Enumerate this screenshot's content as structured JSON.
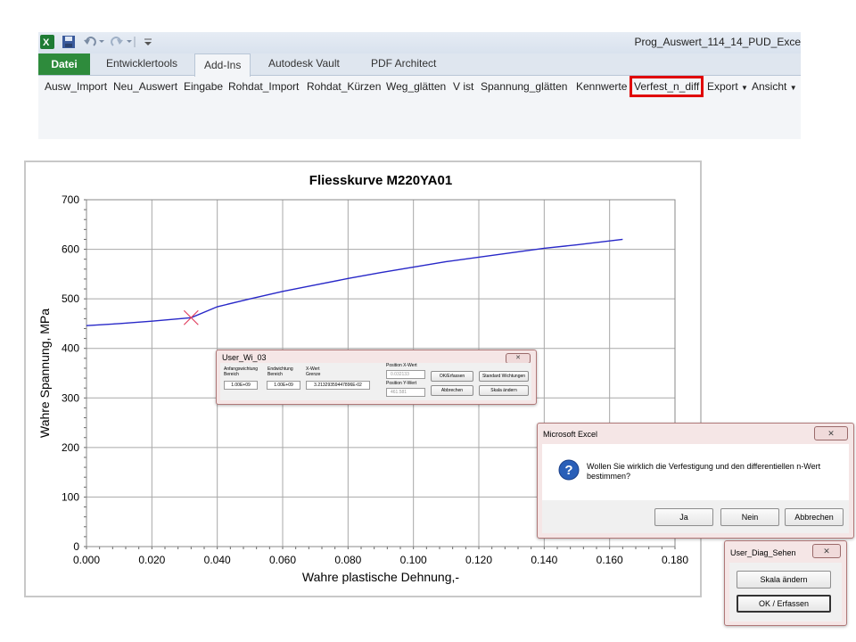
{
  "window": {
    "title": "Prog_Auswert_114_14_PUD_Exce"
  },
  "quick_access": {
    "excel_icon": "excel-logo-icon",
    "save_icon": "save-icon",
    "undo_icon": "undo-icon",
    "redo_icon": "redo-icon"
  },
  "tabs": [
    {
      "label": "Datei"
    },
    {
      "label": "Entwicklertools"
    },
    {
      "label": "Add-Ins"
    },
    {
      "label": "Autodesk Vault"
    },
    {
      "label": "PDF Architect"
    }
  ],
  "commands": [
    "Ausw_Import",
    "Neu_Auswert",
    "Eingabe",
    "Rohdat_Import",
    "Rohdat_Kürzen",
    "Weg_glätten",
    "V ist",
    "Spannung_glätten",
    "Kennwerte",
    "Verfest_n_diff",
    "Export",
    "Ansicht"
  ],
  "colors": {
    "file_tab": "#2e8b3c",
    "highlight": "#e00000",
    "curve": "#2828c8",
    "marker": "#e04060"
  },
  "chart_data": {
    "type": "line",
    "title": "Fliesskurve M220YA01",
    "xlabel": "Wahre plastische Dehnung,-",
    "ylabel": "Wahre Spannung, MPa",
    "xlim": [
      0.0,
      0.18
    ],
    "ylim": [
      0,
      700
    ],
    "x_ticks": [
      "0.000",
      "0.020",
      "0.040",
      "0.060",
      "0.080",
      "0.100",
      "0.120",
      "0.140",
      "0.160",
      "0.180"
    ],
    "y_ticks": [
      "0",
      "100",
      "200",
      "300",
      "400",
      "500",
      "600",
      "700"
    ],
    "grid": true,
    "series": [
      {
        "x": [
          0.0,
          0.01,
          0.02,
          0.032,
          0.04,
          0.05,
          0.06,
          0.07,
          0.08,
          0.09,
          0.1,
          0.11,
          0.12,
          0.13,
          0.14,
          0.15,
          0.164
        ],
        "y": [
          446,
          450,
          455,
          462,
          484,
          500,
          515,
          528,
          541,
          553,
          564,
          575,
          584,
          593,
          602,
          609,
          620
        ]
      }
    ],
    "marker": {
      "x": 0.032,
      "y": 462
    }
  },
  "user_wi_dialog": {
    "title": "User_Wi_03",
    "anfang_label_1": "Anfangswichtung",
    "anfang_label_2": "Bereich",
    "end_label_1": "Endwichtung",
    "end_label_2": "Bereich",
    "xwert_label_1": "X-Wert",
    "xwert_label_2": "Grenze",
    "anfang_value": "1.00E+09",
    "end_value": "1.00E+09",
    "xwert_value": "3.21329359447896E-02",
    "posx_label": "Position  X-Wert",
    "posx_value": "0.032133",
    "posy_label": "Position  Y-Wert",
    "posy_value": "461.581",
    "ok_button": "OK/Erfassen",
    "standard_button": "Standard Wichtungen",
    "cancel_button": "Abbrechen",
    "scale_button": "Skala ändern",
    "close_glyph": "✕"
  },
  "msg_dialog": {
    "title": "Microsoft Excel",
    "message_line1": "Wollen Sie wirklich die Verfestigung und den differentiellen n-Wert",
    "message_line2": "bestimmen?",
    "yes": "Ja",
    "no": "Nein",
    "cancel": "Abbrechen",
    "close_glyph": "✕",
    "icon": "question-icon"
  },
  "diag_dialog": {
    "title": "User_Diag_Sehen",
    "scale_button": "Skala ändern",
    "ok_button": "OK / Erfassen",
    "close_glyph": "✕"
  }
}
